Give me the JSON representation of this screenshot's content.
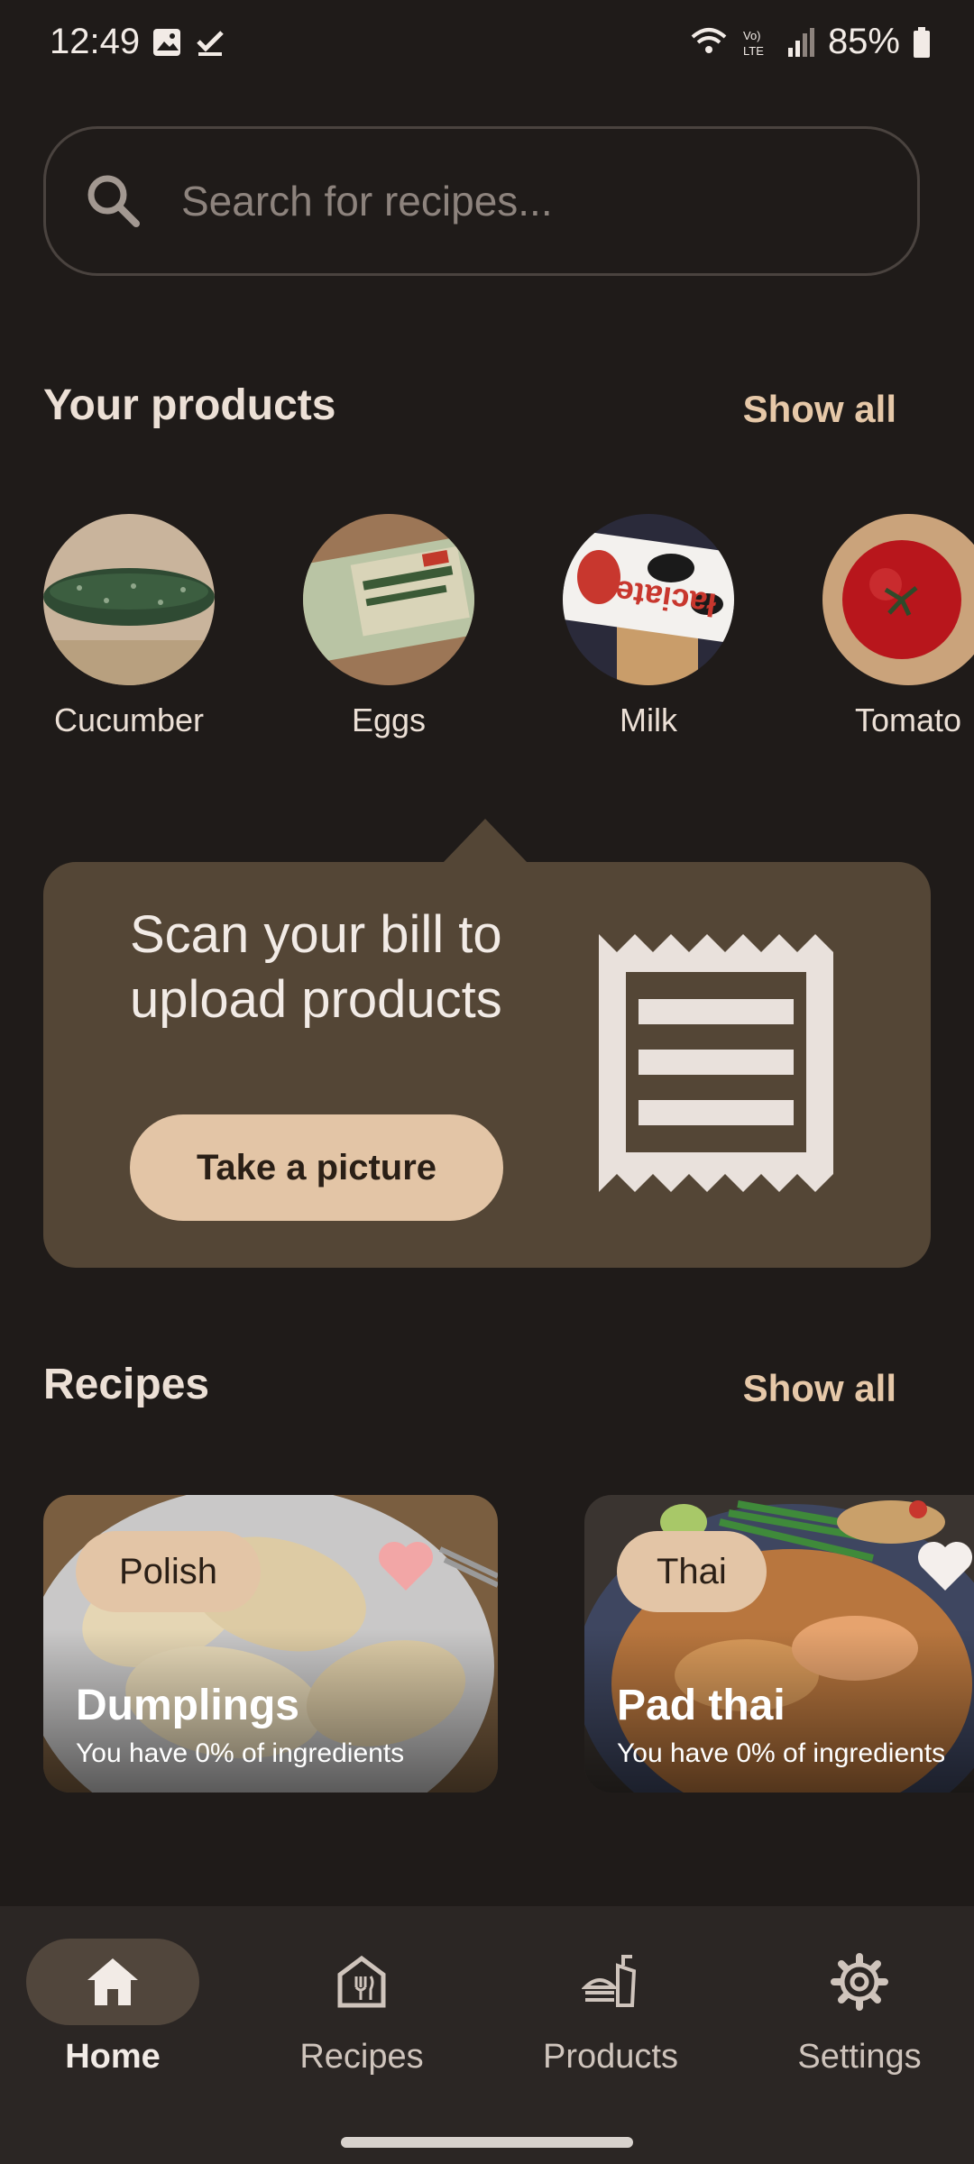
{
  "status_bar": {
    "time": "12:49",
    "battery": "85%",
    "icons": [
      "image-icon",
      "check-icon",
      "wifi-icon",
      "volte-icon",
      "signal-icon",
      "battery-icon"
    ]
  },
  "search": {
    "placeholder": "Search for recipes..."
  },
  "products_section": {
    "title": "Your products",
    "show_all": "Show all",
    "items": [
      {
        "label": "Cucumber"
      },
      {
        "label": "Eggs"
      },
      {
        "label": "Milk"
      },
      {
        "label": "Tomato"
      }
    ]
  },
  "scan_card": {
    "title": "Scan your bill to upload products",
    "button": "Take a picture",
    "icon": "receipt-icon"
  },
  "recipes_section": {
    "title": "Recipes",
    "show_all": "Show all",
    "items": [
      {
        "cuisine": "Polish",
        "name": "Dumplings",
        "ingredients": "You have 0% of ingredients",
        "favorite": true
      },
      {
        "cuisine": "Thai",
        "name": "Pad thai",
        "ingredients": "You have 0% of ingredients",
        "favorite": false
      }
    ]
  },
  "nav": {
    "items": [
      {
        "label": "Home",
        "icon": "home-icon",
        "active": true
      },
      {
        "label": "Recipes",
        "icon": "recipes-icon",
        "active": false
      },
      {
        "label": "Products",
        "icon": "products-icon",
        "active": false
      },
      {
        "label": "Settings",
        "icon": "gear-icon",
        "active": false
      }
    ]
  },
  "colors": {
    "background": "#1f1b19",
    "card": "#544636",
    "accent": "#e3c5a6",
    "favorite": "#f2a6a6"
  }
}
